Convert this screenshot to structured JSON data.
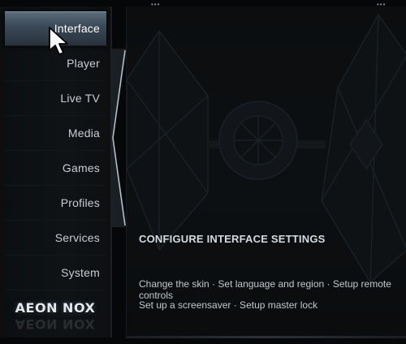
{
  "sidebar": {
    "items": [
      {
        "label": "Interface",
        "active": true
      },
      {
        "label": "Player",
        "active": false
      },
      {
        "label": "Live TV",
        "active": false
      },
      {
        "label": "Media",
        "active": false
      },
      {
        "label": "Games",
        "active": false
      },
      {
        "label": "Profiles",
        "active": false
      },
      {
        "label": "Services",
        "active": false
      },
      {
        "label": "System",
        "active": false
      }
    ],
    "logo": "AEON NOX"
  },
  "main": {
    "title": "CONFIGURE INTERFACE SETTINGS",
    "description_line_1": "Change the skin · Set language and region · Setup remote controls",
    "description_line_2": "Set up a screensaver · Setup master lock"
  },
  "colors": {
    "accent": "#3a4856",
    "text": "#c9ced3",
    "background": "#060708"
  },
  "icons": {
    "cursor": "mouse-pointer-icon",
    "background_art": "tie-fighter-icon"
  }
}
